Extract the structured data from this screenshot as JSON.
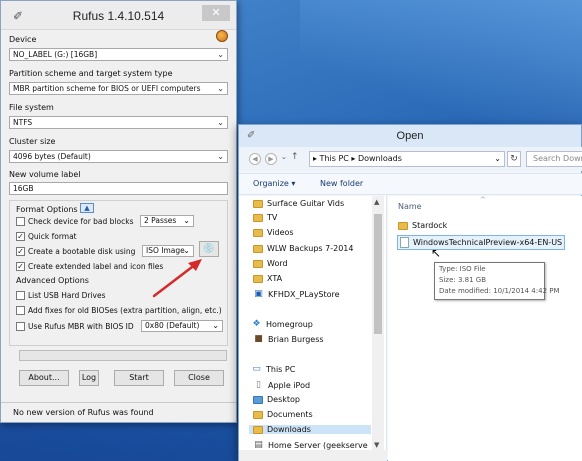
{
  "rufus": {
    "title": "Rufus 1.4.10.514",
    "close": "✕",
    "device_label": "Device",
    "device_value": "NO_LABEL (G:) [16GB]",
    "partition_label": "Partition scheme and target system type",
    "partition_value": "MBR partition scheme for BIOS or UEFI computers",
    "fs_label": "File system",
    "fs_value": "NTFS",
    "cluster_label": "Cluster size",
    "cluster_value": "4096 bytes (Default)",
    "volume_label": "New volume label",
    "volume_value": "16GB",
    "format_options": "Format Options",
    "format_toggle": "▲",
    "check_bad_blocks": "Check device for bad blocks",
    "passes_value": "2 Passes",
    "quick_format": "Quick format",
    "bootable_label": "Create a bootable disk using",
    "boot_type_value": "ISO Image",
    "extended_label": "Create extended label and icon files",
    "advanced_options": "Advanced Options",
    "list_usb": "List USB Hard Drives",
    "add_fixes": "Add fixes for old BIOSes (extra partition, align, etc.)",
    "use_mbr": "Use Rufus MBR with BIOS ID",
    "bios_id_value": "0x80 (Default)",
    "about_btn": "About...",
    "log_btn": "Log",
    "start_btn": "Start",
    "close_btn": "Close",
    "status": "No new version of Rufus was found",
    "checked": {
      "bad_blocks": false,
      "quick_format": true,
      "bootable": true,
      "extended": true,
      "list_usb": false,
      "add_fixes": false,
      "use_mbr": false
    }
  },
  "open_dialog": {
    "title": "Open",
    "breadcrumb": "▸ This PC ▸ Downloads",
    "search_placeholder": "Search Downloads",
    "toolbar": {
      "organize": "Organize ▾",
      "new_folder": "New folder"
    },
    "nav_items": [
      {
        "label": "Surface Guitar Vids",
        "icon": "folder"
      },
      {
        "label": "TV",
        "icon": "folder"
      },
      {
        "label": "Videos",
        "icon": "folder"
      },
      {
        "label": "WLW Backups 7-2014",
        "icon": "folder"
      },
      {
        "label": "Word",
        "icon": "folder"
      },
      {
        "label": "XTA",
        "icon": "folder"
      },
      {
        "label": "KFHDX_PLayStore",
        "icon": "app"
      },
      {
        "label": "Homegroup",
        "icon": "homegroup"
      },
      {
        "label": "Brian Burgess",
        "icon": "user"
      },
      {
        "label": "This PC",
        "icon": "computer"
      },
      {
        "label": "Apple iPod",
        "icon": "device"
      },
      {
        "label": "Desktop",
        "icon": "folder"
      },
      {
        "label": "Documents",
        "icon": "folder"
      },
      {
        "label": "Downloads",
        "icon": "folder"
      },
      {
        "label": "Home Server (geekserve",
        "icon": "drive"
      }
    ],
    "column_name": "Name",
    "files": [
      {
        "name": "Stardock",
        "type": "folder"
      },
      {
        "name": "WindowsTechnicalPreview-x64-EN-US",
        "type": "iso"
      }
    ],
    "tooltip": {
      "type": "Type: ISO File",
      "size": "Size: 3.81 GB",
      "modified": "Date modified: 10/1/2014 4:42 PM"
    }
  },
  "colors": {
    "desktop": "#2f6fbb",
    "arrow": "#d42a2a",
    "selection": "#cde4f8"
  }
}
